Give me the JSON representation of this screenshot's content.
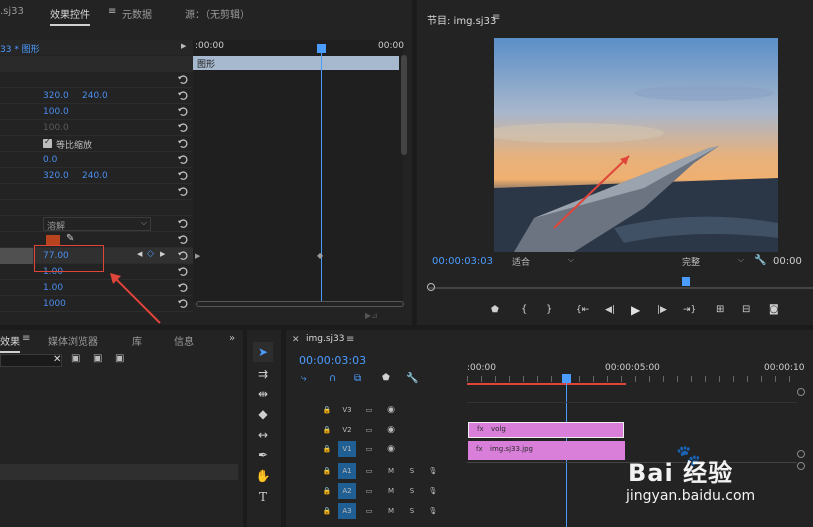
{
  "effect_controls": {
    "tabs": [
      {
        "label": ".sj33"
      },
      {
        "label": "效果控件"
      },
      {
        "label": "元数据"
      },
      {
        "label": "源：（无剪辑）"
      }
    ],
    "clip_label": "33 * 图形",
    "time_start": ":00:00",
    "time_end": "00:00",
    "layer_label": "图形",
    "values": {
      "pos_x": "320.0",
      "pos_y": "240.0",
      "scale": "100.0",
      "scale_width": "100.0",
      "uniform_scale": "等比缩放",
      "rotation": "0.0",
      "anchor_x": "320.0",
      "anchor_y": "240.0",
      "blend_mode": "溶解",
      "opacity_value": "77.00",
      "v1": "1.00",
      "v2": "1.00",
      "v3": "1000"
    }
  },
  "program_monitor": {
    "title": "节目: img.sj33",
    "timecode": "00:00:03:03",
    "fit": "适合",
    "quality": "完整",
    "timecode_right": "00:00"
  },
  "project_panel": {
    "tabs": [
      {
        "label": "效果"
      },
      {
        "label": "媒体浏览器"
      },
      {
        "label": "库"
      },
      {
        "label": "信息"
      }
    ]
  },
  "timeline": {
    "seq_tab": "img.sj33",
    "timecode": "00:00:03:03",
    "ruler": [
      ":00:00",
      "00:00:05:00",
      "00:00:10"
    ],
    "tracks": [
      {
        "name": "V3"
      },
      {
        "name": "V2"
      },
      {
        "name": "V1"
      },
      {
        "name": "A1",
        "m": "M",
        "s": "S"
      },
      {
        "name": "A2",
        "m": "M",
        "s": "S"
      },
      {
        "name": "A3",
        "m": "M",
        "s": "S"
      }
    ],
    "clips": {
      "v2_label": "volg",
      "v1_label": "img.sj33.jpg"
    }
  },
  "watermark": {
    "logo_text": "Bai 经验",
    "url": "jingyan.baidu.com"
  },
  "colors": {
    "accent": "#4b9cff",
    "clip_pink": "#d97fd9",
    "highlight_red": "#e0453a",
    "track_blue": "#1f5f93"
  }
}
